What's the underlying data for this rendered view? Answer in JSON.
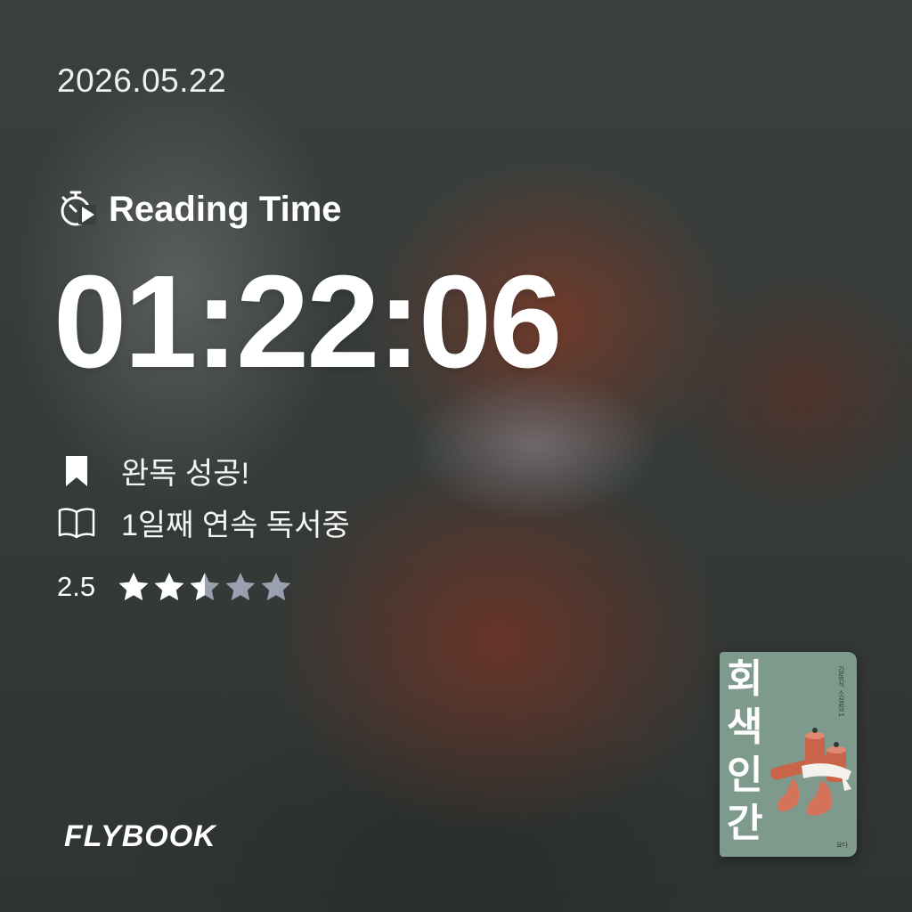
{
  "date": "2026.05.22",
  "reading_time": {
    "label": "Reading Time",
    "icon": "stopwatch-play-icon",
    "value": "01:22:06"
  },
  "status": {
    "completed": {
      "icon": "bookmark-icon",
      "text": "완독 성공!"
    },
    "streak": {
      "icon": "open-book-icon",
      "text": "1일째 연속 독서중"
    }
  },
  "rating": {
    "score": "2.5",
    "value": 2.5,
    "max": 5,
    "filled_color": "#ffffff",
    "empty_color": "#9aa0b0"
  },
  "brand": "FLYBOOK",
  "book": {
    "title_chars": [
      "회",
      "색",
      "인",
      "간"
    ],
    "series": "김동식 소설집 1",
    "publisher": "요다",
    "cover_color": "#7e9a8c"
  }
}
